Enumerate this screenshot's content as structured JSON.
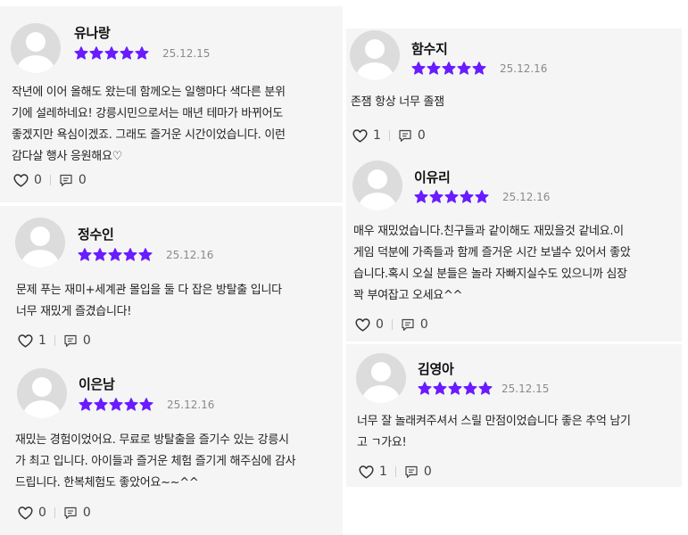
{
  "colors": {
    "star": "#6a1bff",
    "card_bg": "#f5f5f5",
    "avatar_bg": "#dcdcdc"
  },
  "reviews": [
    {
      "name": "유나랑",
      "rating": 5,
      "date": "25.12.15",
      "lines": [
        "작년에 이어 올해도 왔는데 함께오는 일행마다 색다른 분위",
        "기에 설레하네요! 강릉시민으로서는 매년 테마가 바뀌어도",
        "좋겠지만 욕심이겠죠. 그래도 즐거운 시간이었습니다. 이런",
        "감다살 행사 응원해요♡"
      ],
      "likes": "0",
      "comments": "0"
    },
    {
      "name": "정수인",
      "rating": 5,
      "date": "25.12.16",
      "lines": [
        "문제 푸는 재미+세계관 몰입을 둘 다 잡은 방탈출 입니다",
        "너무 재밌게 즐겼습니다!"
      ],
      "likes": "1",
      "comments": "0"
    },
    {
      "name": "이은남",
      "rating": 5,
      "date": "25.12.16",
      "lines": [
        "재밌는 경험이었어요. 무료로 방탈출을 즐기수 있는 강릉시",
        "가 최고 입니다. 아이들과 즐거운 체험 즐기게 해주심에 감사",
        "드립니다. 한복체험도 좋았어요~~^^"
      ],
      "likes": "0",
      "comments": "0"
    },
    {
      "name": "함수지",
      "rating": 5,
      "date": "25.12.16",
      "lines": [
        "존잼 항상 너무 졸잼"
      ],
      "likes": "1",
      "comments": "0"
    },
    {
      "name": "이유리",
      "rating": 5,
      "date": "25.12.16",
      "lines": [
        "매우 재밌었습니다.친구들과 같이해도 재밌을것 같네요.이",
        "게임 덕분에 가족들과 함께 즐거운 시간 보낼수 있어서 좋았",
        "습니다.혹시 오실 분들은 놀라 자빠지실수도 있으니까 심장",
        "꽉 부여잡고 오세요^^"
      ],
      "likes": "0",
      "comments": "0"
    },
    {
      "name": "김영아",
      "rating": 5,
      "date": "25.12.15",
      "lines": [
        "너무 잘 놀래켜주셔서 스릴 만점이었습니다 좋은 추억 남기",
        "고 ㄱ가요!"
      ],
      "likes": "1",
      "comments": "0"
    }
  ]
}
